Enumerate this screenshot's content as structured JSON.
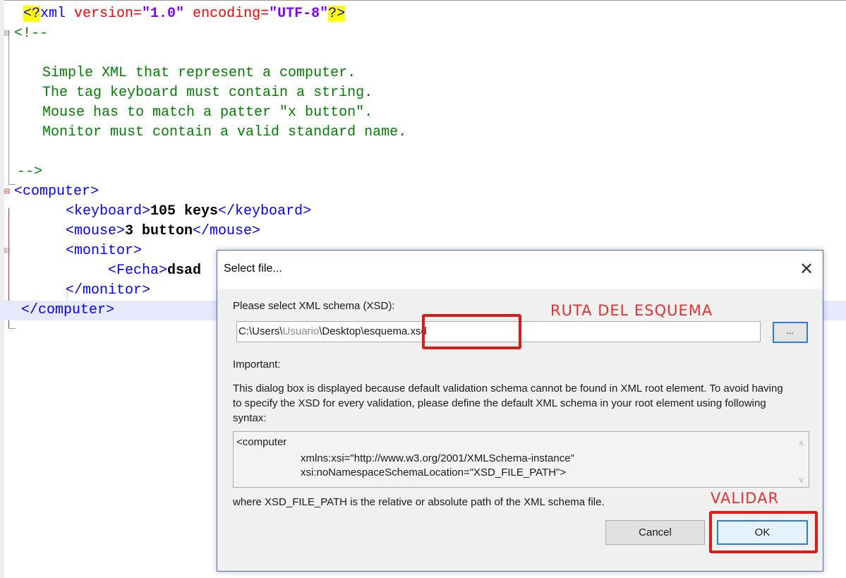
{
  "editor": {
    "lines": {
      "decl_open": "<?",
      "decl_name": "xml ",
      "decl_version_attr": "version=",
      "decl_version_val": "\"1.0\"",
      "decl_encoding_attr": " encoding=",
      "decl_encoding_val": "\"UTF-8\"",
      "decl_close": "?>",
      "comment_open": "<!--",
      "comment_1": "Simple XML that represent a computer.",
      "comment_2": "The tag keyboard must contain a string.",
      "comment_3": "Mouse has to match a patter \"x button\".",
      "comment_4": "Monitor must contain a valid standard name.",
      "comment_close": "-->",
      "computer_open": "<computer>",
      "keyboard_open": "<keyboard>",
      "keyboard_val": "105 keys",
      "keyboard_close": "</keyboard>",
      "mouse_open": "<mouse>",
      "mouse_val": "3 button",
      "mouse_close": "</mouse>",
      "monitor_open": "<monitor>",
      "fecha_open": "<Fecha>",
      "fecha_val": "dsad",
      "monitor_close": "</monitor>",
      "computer_close": "</computer>"
    }
  },
  "dialog": {
    "title": "Select file...",
    "close_glyph": "✕",
    "prompt_label": "Please select XML schema (XSD):",
    "path_prefix": "C:\\Users\\",
    "path_user_blurred": "Usuario",
    "path_suffix": "\\Desktop\\",
    "path_file": "esquema.xsd",
    "browse_label": "...",
    "important_label": "Important:",
    "description": "This dialog box is displayed because default validation schema cannot be found in XML root element. To avoid having to specify the XSD for every validation, please define the default XML schema in your root element using following syntax:",
    "code_line_1": "<computer",
    "code_line_2": "xmlns:xsi=\"http://www.w3.org/2001/XMLSchema-instance\"",
    "code_line_3": "xsi:noNamespaceSchemaLocation=\"XSD_FILE_PATH\">",
    "footer_text": "where XSD_FILE_PATH is the relative or absolute path of the XML schema file.",
    "cancel_label": "Cancel",
    "ok_label": "OK"
  },
  "annotations": {
    "schema_path_label": "RUTA DEL ESQUEMA",
    "validate_label": "VALIDAR",
    "color": "#dd1a1a"
  },
  "colors": {
    "xml_tag": "#0000ff",
    "xml_attr": "#ff0000",
    "xml_value": "#8000ff",
    "comment": "#008000",
    "current_line": "#e8e8ff",
    "highlight": "#ffff00",
    "dialog_accent": "#2d7dd2"
  }
}
